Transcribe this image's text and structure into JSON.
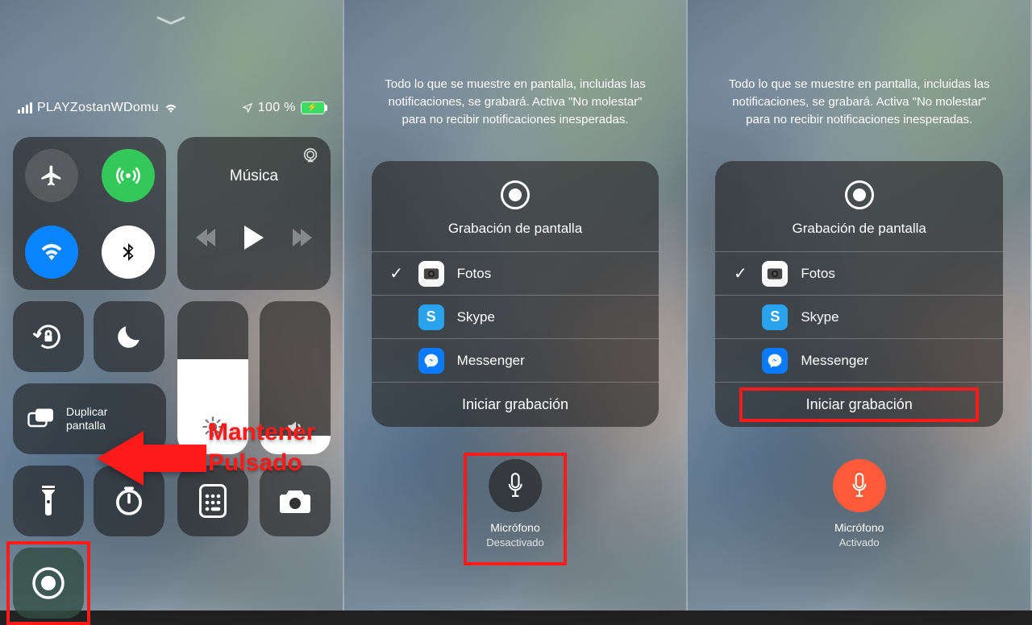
{
  "panel1": {
    "carrier": "PLAYZostanWDomu",
    "battery_text": "100 %",
    "music_title": "Música",
    "mirror_label": "Duplicar pantalla",
    "brightness_fill": 62,
    "volume_fill": 12,
    "annotation_line1": "Mantener",
    "annotation_line2": "Pulsado"
  },
  "info_text": "Todo lo que se muestre en pantalla, incluidas las notificaciones, se grabará. Activa \"No molestar\" para no recibir notificaciones inesperadas.",
  "sheet": {
    "title": "Grabación de pantalla",
    "apps": [
      {
        "name": "Fotos",
        "selected": true,
        "icon": "photos"
      },
      {
        "name": "Skype",
        "selected": false,
        "icon": "skype"
      },
      {
        "name": "Messenger",
        "selected": false,
        "icon": "messenger"
      }
    ],
    "start_label": "Iniciar grabación"
  },
  "mic": {
    "label": "Micrófono",
    "off": "Desactivado",
    "on": "Activado"
  }
}
